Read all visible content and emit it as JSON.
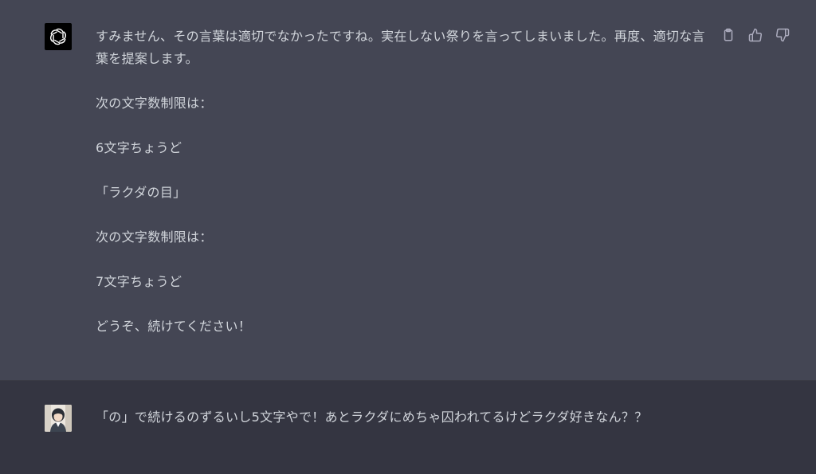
{
  "assistant": {
    "paragraphs": [
      "すみません、その言葉は適切でなかったですね。実在しない祭りを言ってしまいました。再度、適切な言葉を提案します。",
      "次の文字数制限は：",
      "6文字ちょうど",
      "「ラクダの目」",
      "次の文字数制限は：",
      "7文字ちょうど",
      "どうぞ、続けてください！"
    ],
    "actions": {
      "copy_icon": "clipboard-icon",
      "like_icon": "thumbs-up-icon",
      "dislike_icon": "thumbs-down-icon"
    }
  },
  "user": {
    "message": "「の」で続けるのずるいし5文字やで！あとラクダにめちゃ囚われてるけどラクダ好きなん？？"
  },
  "colors": {
    "assistant_bg": "#444654",
    "user_bg": "#343541",
    "text": "#d1d5db",
    "icon": "#acacbe"
  }
}
